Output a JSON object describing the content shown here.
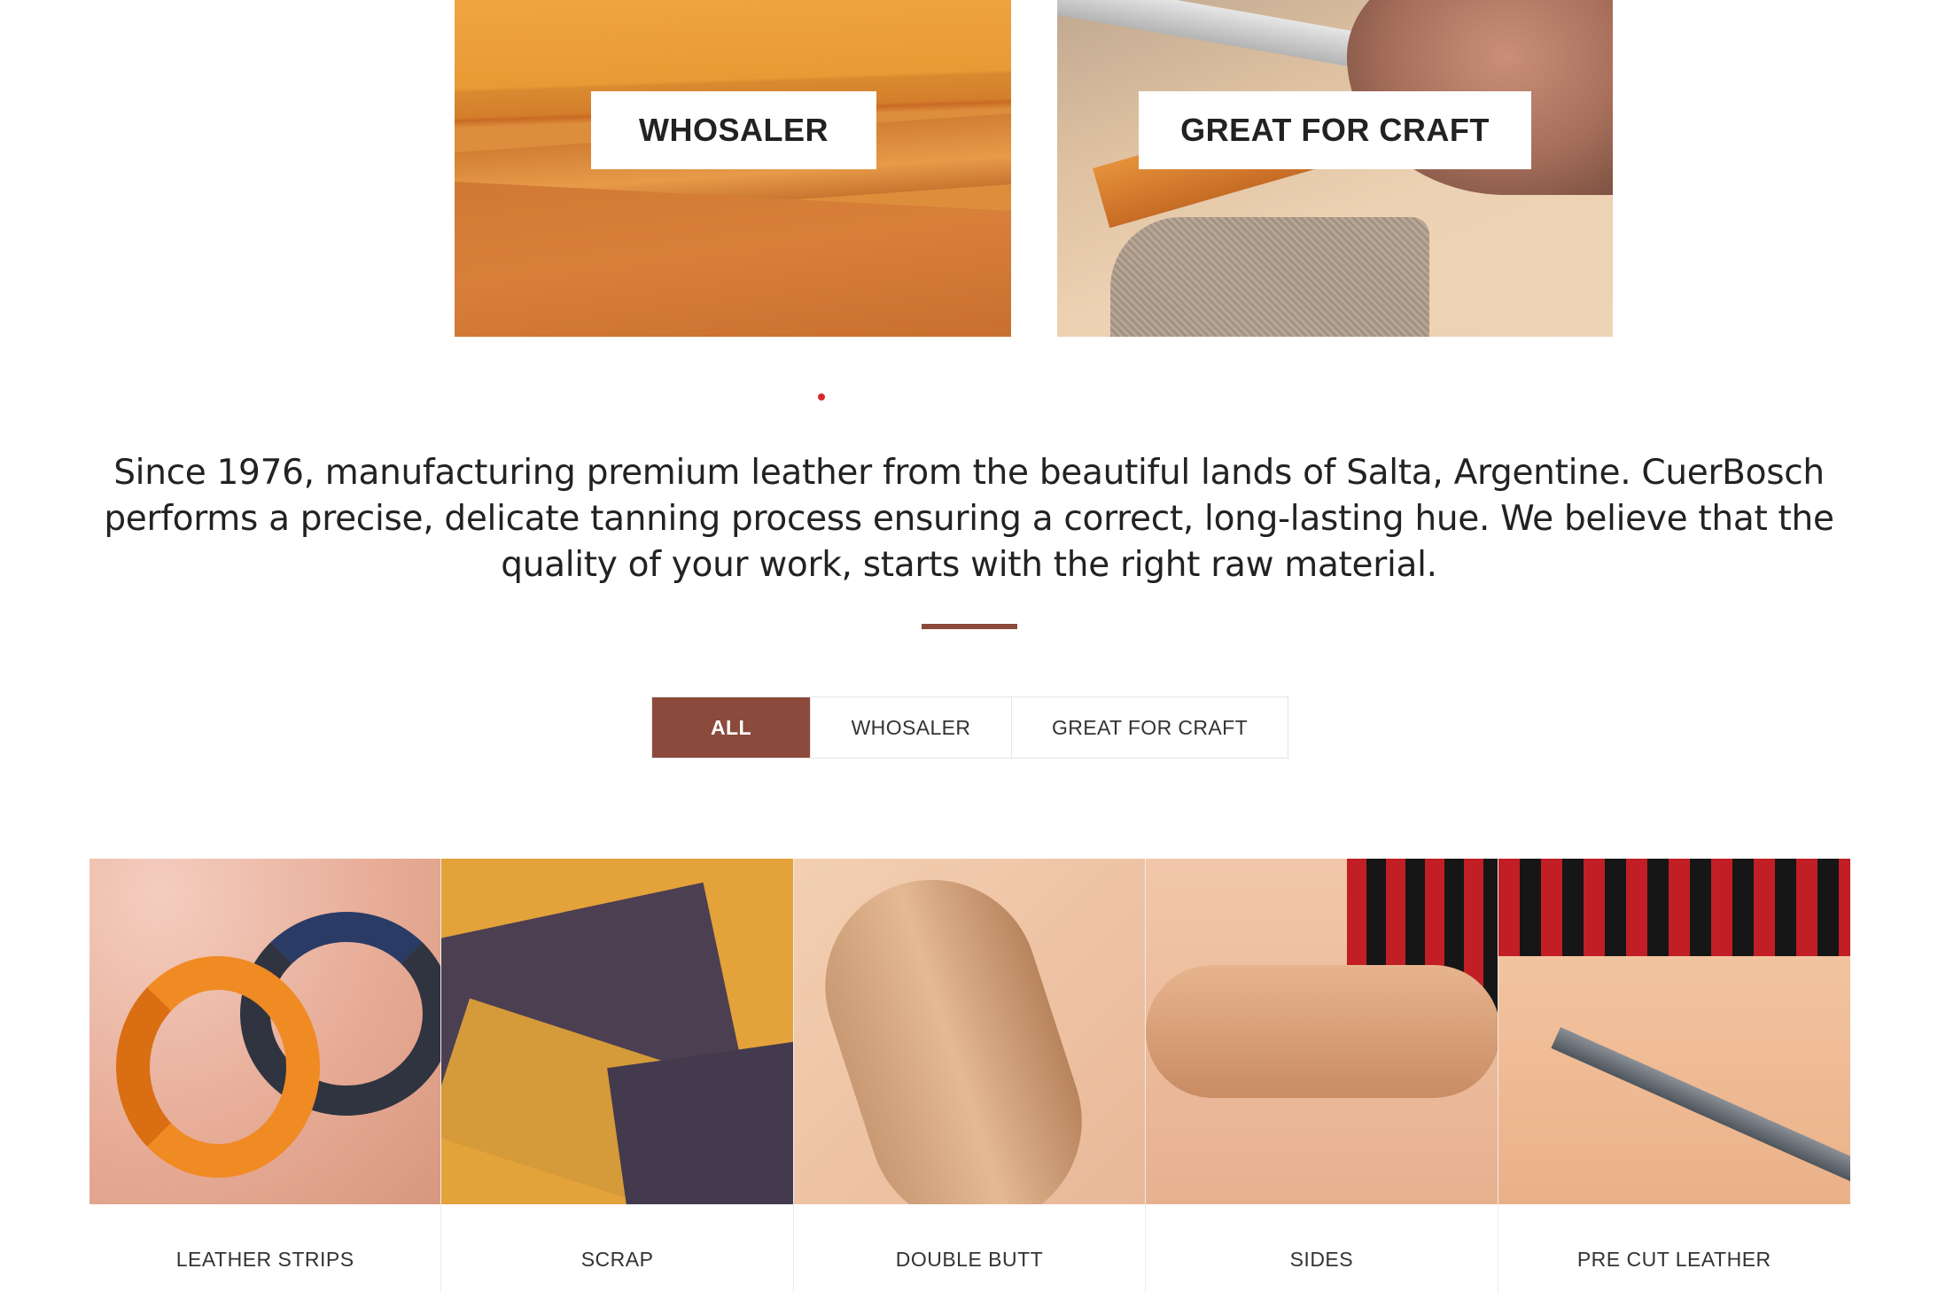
{
  "banners": [
    {
      "label": "WHOSALER"
    },
    {
      "label": "GREAT FOR CRAFT"
    }
  ],
  "intro": {
    "text": "Since 1976, manufacturing premium leather from the beautiful lands of Salta, Argentine. CuerBosch performs a precise, delicate tanning process ensuring a correct, long-lasting hue. We believe that the quality of your work, starts with the right raw material."
  },
  "filters": {
    "all": "ALL",
    "whosaler": "WHOSALER",
    "craft": "GREAT FOR CRAFT",
    "active": "ALL"
  },
  "products": [
    {
      "label": "LEATHER STRIPS"
    },
    {
      "label": "SCRAP"
    },
    {
      "label": "DOUBLE BUTT"
    },
    {
      "label": "SIDES"
    },
    {
      "label": "PRE CUT LEATHER"
    }
  ],
  "colors": {
    "accent": "#8b4a3c",
    "dot": "#d9262c"
  }
}
